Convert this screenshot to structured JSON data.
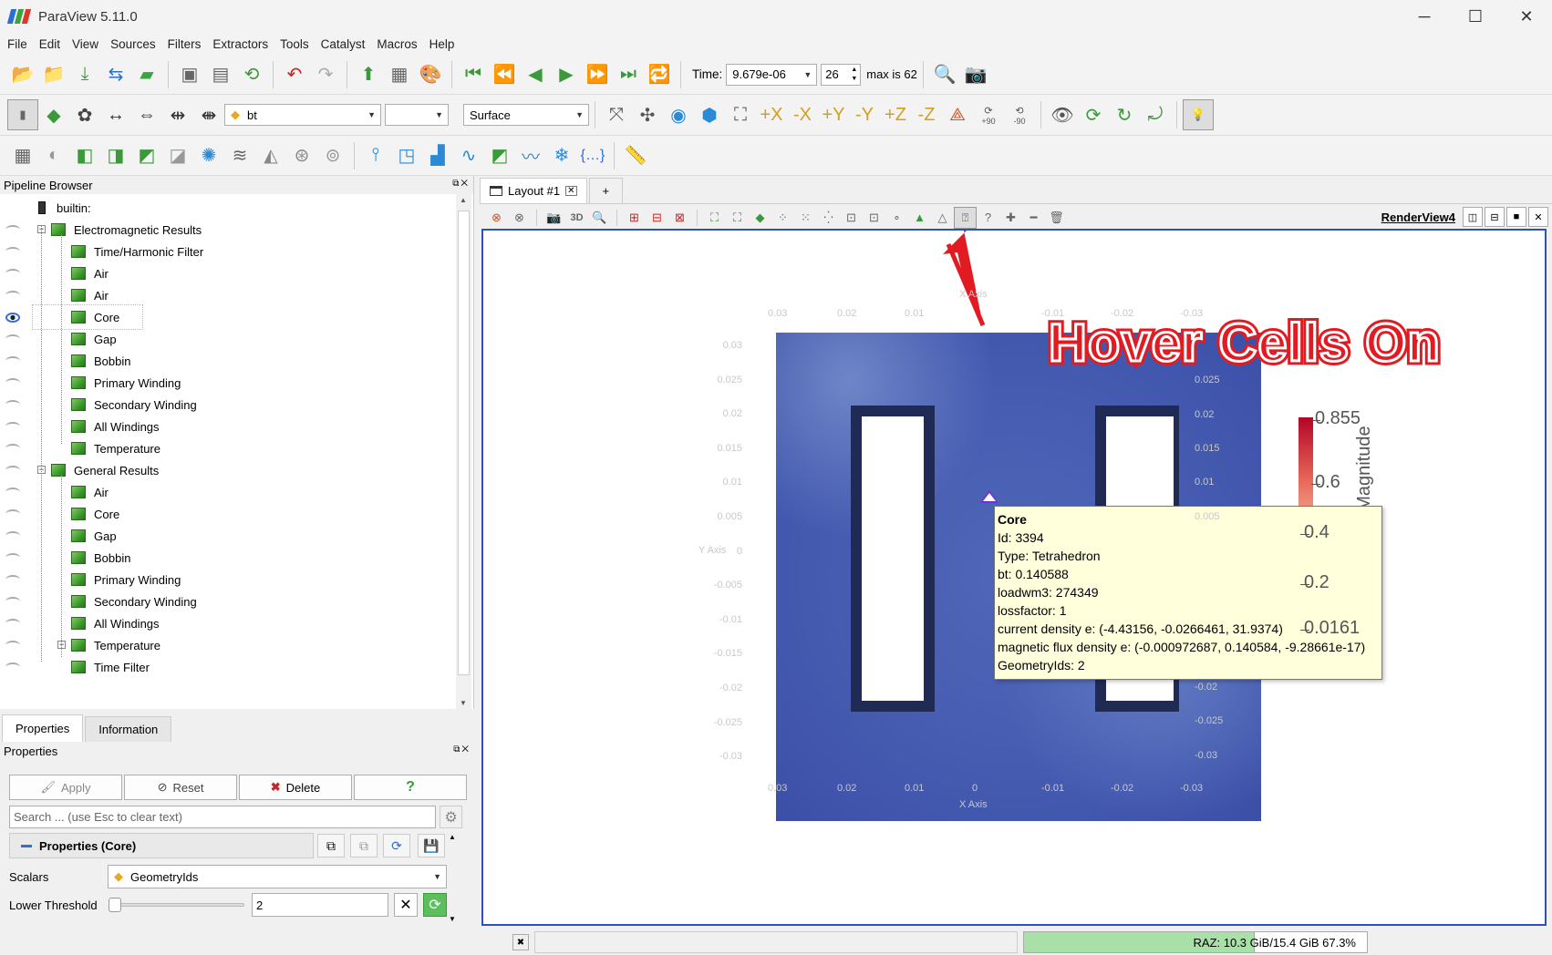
{
  "app": {
    "title": "ParaView 5.11.0"
  },
  "menu": [
    "File",
    "Edit",
    "View",
    "Sources",
    "Filters",
    "Extractors",
    "Tools",
    "Catalyst",
    "Macros",
    "Help"
  ],
  "time": {
    "label": "Time:",
    "value": "9.679e-06",
    "step": "26",
    "max_text": "max is 62"
  },
  "toolbar2": {
    "array": "bt",
    "component": "",
    "representation": "Surface",
    "rot_plus": "+90",
    "rot_minus": "-90"
  },
  "pipeline": {
    "header": "Pipeline Browser",
    "root": "builtin:",
    "items": [
      {
        "label": "Electromagnetic Results",
        "level": 1
      },
      {
        "label": "Time/Harmonic Filter",
        "level": 2
      },
      {
        "label": "Air",
        "level": 2
      },
      {
        "label": "Air",
        "level": 2
      },
      {
        "label": "Core",
        "level": 2,
        "visible": true
      },
      {
        "label": "Gap",
        "level": 2
      },
      {
        "label": "Bobbin",
        "level": 2
      },
      {
        "label": "Primary Winding",
        "level": 2
      },
      {
        "label": "Secondary Winding",
        "level": 2
      },
      {
        "label": "All Windings",
        "level": 2
      },
      {
        "label": "Temperature",
        "level": 2
      },
      {
        "label": "General Results",
        "level": 1
      },
      {
        "label": "Air",
        "level": 2
      },
      {
        "label": "Core",
        "level": 2
      },
      {
        "label": "Gap",
        "level": 2
      },
      {
        "label": "Bobbin",
        "level": 2
      },
      {
        "label": "Primary Winding",
        "level": 2
      },
      {
        "label": "Secondary Winding",
        "level": 2
      },
      {
        "label": "All Windings",
        "level": 2
      },
      {
        "label": "Temperature",
        "level": 2
      },
      {
        "label": "Time Filter",
        "level": 3
      }
    ]
  },
  "tabs": {
    "properties": "Properties",
    "information": "Information"
  },
  "properties": {
    "header": "Properties",
    "apply": "Apply",
    "reset": "Reset",
    "delete": "Delete",
    "help": "?",
    "search_placeholder": "Search ... (use Esc to clear text)",
    "section": "Properties (Core)",
    "scalars_label": "Scalars",
    "scalars_value": "GeometryIds",
    "lower_threshold_label": "Lower Threshold",
    "lower_threshold_value": "2",
    "lower_threshold_slider_fraction": 0.0
  },
  "layout": {
    "tab": "Layout #1",
    "plus": "+",
    "view_name": "RenderView4",
    "btn_3d": "3D"
  },
  "axes": {
    "x_label": "X Axis",
    "y_label": "Y Axis",
    "x_ticks": [
      "0.03",
      "0.02",
      "0.01",
      "0",
      "-0.01",
      "-0.02",
      "-0.03"
    ],
    "y_ticks": [
      "0.03",
      "0.025",
      "0.02",
      "0.015",
      "0.01",
      "0.005",
      "0",
      "-0.005",
      "-0.01",
      "-0.015",
      "-0.02",
      "-0.025",
      "-0.03"
    ],
    "right_ticks": [
      "0.025",
      "0.02",
      "0.015",
      "0.01",
      "0.005",
      "-0.02",
      "-0.025",
      "-0.03"
    ]
  },
  "tooltip": {
    "title": "Core",
    "lines": [
      "Id: 3394",
      "Type: Tetrahedron",
      "bt: 0.140588",
      "loadwm3: 274349",
      "lossfactor: 1",
      "current density e: (-4.43156, -0.0266461, 31.9374)",
      "magnetic flux density e: (-0.000972687, 0.140584, -9.28661e-17)",
      "GeometryIds: 2"
    ]
  },
  "annotation": "Hover Cells On",
  "colorbar": {
    "title": "bt Magnitude",
    "ticks": [
      "0.855",
      "0.6",
      "0.4",
      "0.2",
      "0.0161"
    ]
  },
  "status": {
    "memory": "RAZ: 10.3 GiB/15.4 GiB 67.3%",
    "memory_fraction": 0.673
  },
  "colors": {
    "render_border": "#2f4fbf",
    "annotation": "#e21b23",
    "tooltip_bg": "#ffffdc"
  }
}
